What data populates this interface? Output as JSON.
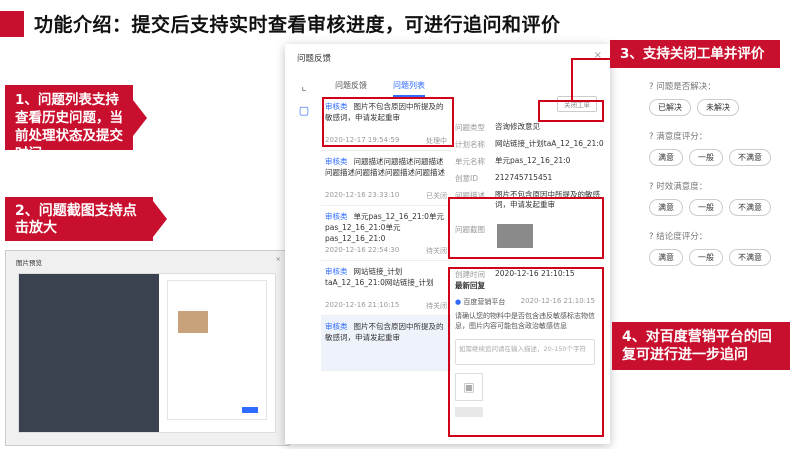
{
  "slide": {
    "title": "功能介绍：提交后支持实时查看审核进度，可进行追问和评价"
  },
  "callouts": {
    "c1": "1、问题列表支持查看历史问题，当前处理状态及提交时间",
    "c2": "2、问题截图支持点击放大",
    "c3": "3、支持关闭工单并评价",
    "c4": "4、对百度营销平台的回复可进行进一步追问"
  },
  "dialog": {
    "title": "问题反馈",
    "close": "×",
    "tabs": [
      "问题反馈",
      "问题列表"
    ],
    "active_tab": 1,
    "list": [
      {
        "tag": "审核类",
        "text": "图片不包含原因中所提及的敏感词，申请发起重审",
        "time": "2020-12-17 19:54:59",
        "status": "处理中"
      },
      {
        "tag": "审核类",
        "text": "问题描述问题描述问题描述问题描述问题描述问题描述问题描述",
        "time": "2020-12-16 23:33:10",
        "status": "已关闭"
      },
      {
        "tag": "审核类",
        "text": "单元pas_12_16_21:0单元pas_12_16_21:0单元pas_12_16_21:0",
        "time": "2020-12-16 22:54:30",
        "status": "待关闭"
      },
      {
        "tag": "审核类",
        "text": "网站链接_计划taA_12_16_21:0网站链接_计划",
        "time": "2020-12-16 21:10:15",
        "status": "待关闭"
      },
      {
        "tag": "审核类",
        "text": "图片不包含原因中所提及的敏感词，申请发起重审",
        "time": "",
        "status": ""
      }
    ],
    "detail": {
      "close_ticket": "关闭工单",
      "rows": [
        {
          "k": "问题类型",
          "v": "咨询修改意见"
        },
        {
          "k": "计划名称",
          "v": "网站链接_计划taA_12_16_21:0"
        },
        {
          "k": "单元名称",
          "v": "单元pas_12_16_21:0"
        },
        {
          "k": "创意ID",
          "v": "212745715451"
        },
        {
          "k": "问题描述",
          "v": "图片不包含原因中所提及的敏感词，申请发起重审"
        },
        {
          "k": "问题截图",
          "v": ""
        },
        {
          "k": "创建时间",
          "v": "2020-12-16 21:10:15"
        }
      ],
      "reply_head": "最新回复",
      "reply_src": "百度营销平台",
      "reply_time": "2020-12-16 21:10:15",
      "reply_body": "请确认您的物料中是否包含违反敏感标志物信息，图片内容可能包含政治敏感信息",
      "reply_placeholder": "如需继续追问请在输入描述，20-150个字符"
    }
  },
  "rating": {
    "questions": [
      {
        "label": "问题是否解决：",
        "options": [
          "已解决",
          "未解决"
        ]
      },
      {
        "label": "满意度评分：",
        "options": [
          "满意",
          "一般",
          "不满意"
        ]
      },
      {
        "label": "时效满意度：",
        "options": [
          "满意",
          "一般",
          "不满意"
        ]
      },
      {
        "label": "结论度评分：",
        "options": [
          "满意",
          "一般",
          "不满意"
        ]
      }
    ]
  },
  "preview": {
    "title": "图片预览",
    "close": "×"
  }
}
